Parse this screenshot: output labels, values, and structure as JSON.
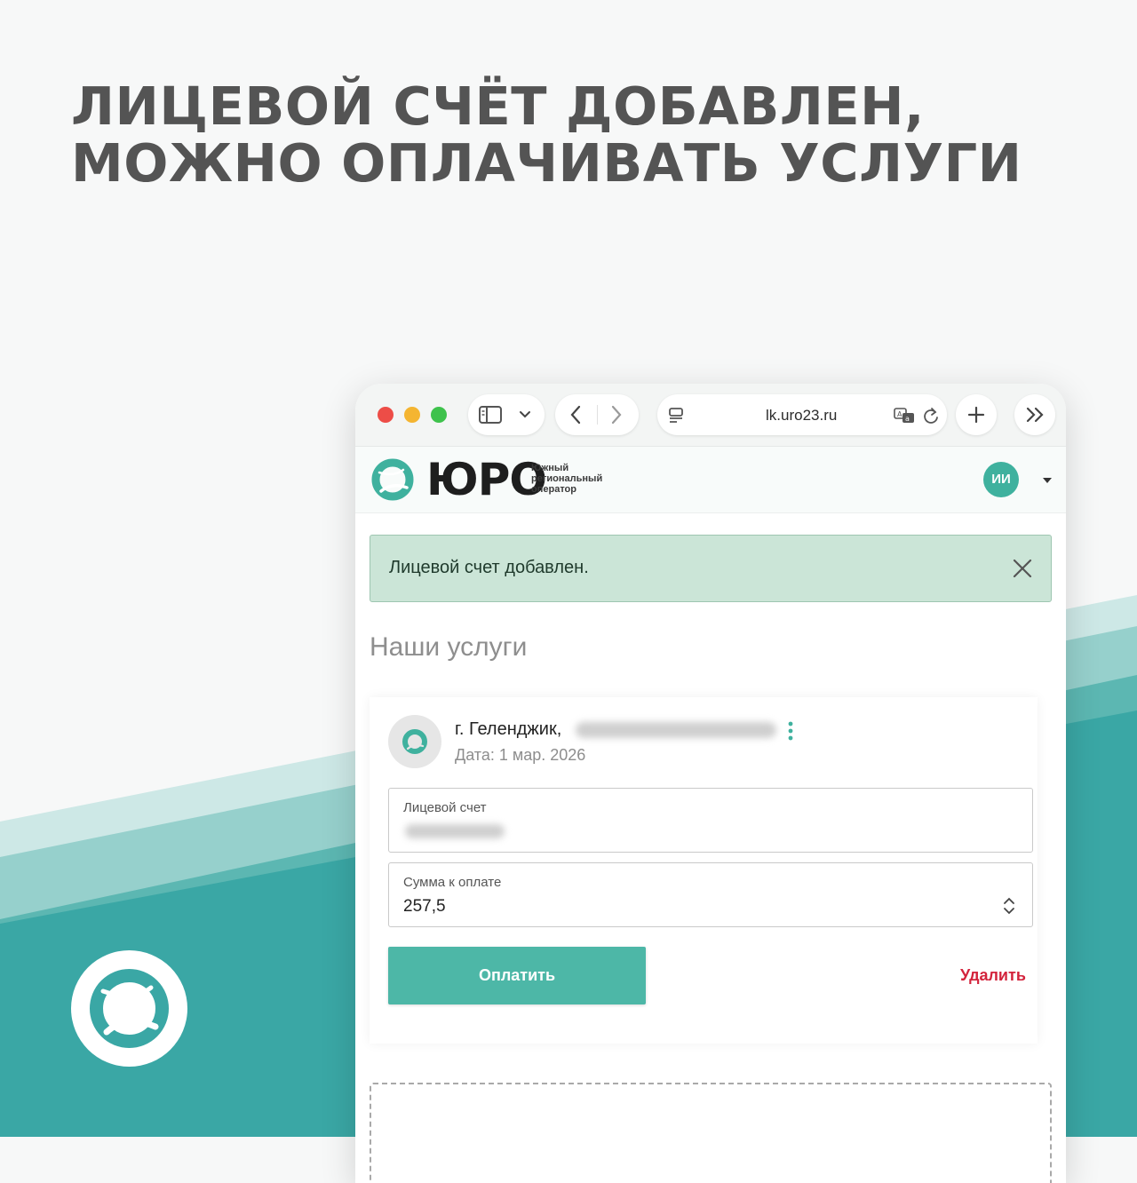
{
  "headline": {
    "line1": "ЛИЦЕВОЙ СЧЁТ ДОБАВЛЕН,",
    "line2": "МОЖНО ОПЛАЧИВАТЬ УСЛУГИ"
  },
  "colors": {
    "brand_teal": "#3fb19e",
    "button_teal": "#4db7a7",
    "alert_bg": "#cbe5d7",
    "delete_red": "#d3233c",
    "headline_gray": "#545454"
  },
  "browser": {
    "url": "lk.uro23.ru",
    "icons": [
      "sidebar-icon",
      "chevron-down-icon",
      "back-icon",
      "forward-icon",
      "tab-list-icon",
      "translate-icon",
      "reload-icon",
      "new-tab-icon",
      "more-icon"
    ]
  },
  "site": {
    "logo_text": "ЮРО",
    "tagline": [
      "Южный",
      "региональный",
      "оператор"
    ],
    "user_initials": "ИИ"
  },
  "alert": {
    "message": "Лицевой счет добавлен."
  },
  "services": {
    "title": "Наши услуги",
    "card": {
      "address": "г. Геленджик,",
      "date": "Дата: 1 мар. 2026",
      "account_label": "Лицевой счет",
      "amount_label": "Сумма к оплате",
      "amount_value": "257,5",
      "pay_label": "Оплатить",
      "delete_label": "Удалить"
    }
  }
}
